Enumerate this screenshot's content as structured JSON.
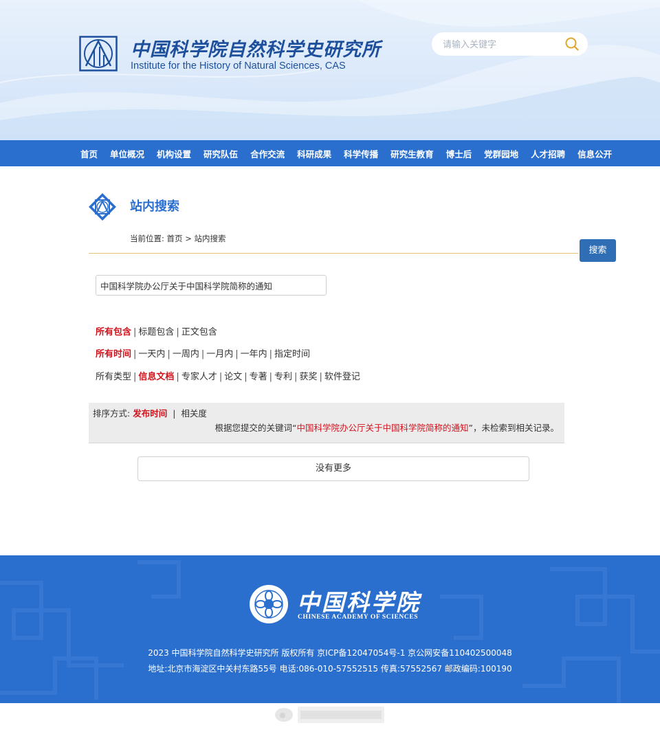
{
  "header": {
    "logo_cn": "中国科学院自然科学史研究所",
    "logo_en": "Institute for the History of Natural Sciences, CAS",
    "search_placeholder": "请输入关键字"
  },
  "nav": {
    "items": [
      "首页",
      "单位概况",
      "机构设置",
      "研究队伍",
      "合作交流",
      "科研成果",
      "科学传播",
      "研究生教育",
      "博士后",
      "党群园地",
      "人才招聘",
      "信息公开"
    ]
  },
  "page": {
    "title": "站内搜索",
    "breadcrumb_prefix": "当前位置:",
    "breadcrumb_home": "首页",
    "breadcrumb_sep": ">",
    "breadcrumb_current": "站内搜索",
    "search_button": "搜索",
    "keyword_value": "中国科学院办公厅关于中国科学院简称的通知"
  },
  "filters": {
    "scope": [
      {
        "label": "所有包含",
        "active": true
      },
      {
        "label": "标题包含",
        "active": false
      },
      {
        "label": "正文包含",
        "active": false
      }
    ],
    "time": [
      {
        "label": "所有时间",
        "active": true
      },
      {
        "label": "一天内",
        "active": false
      },
      {
        "label": "一周内",
        "active": false
      },
      {
        "label": "一月内",
        "active": false
      },
      {
        "label": "一年内",
        "active": false
      },
      {
        "label": "指定时间",
        "active": false
      }
    ],
    "type": [
      {
        "label": "所有类型",
        "active": false
      },
      {
        "label": "信息文档",
        "active": true
      },
      {
        "label": "专家人才",
        "active": false
      },
      {
        "label": "论文",
        "active": false
      },
      {
        "label": "专著",
        "active": false
      },
      {
        "label": "专利",
        "active": false
      },
      {
        "label": "获奖",
        "active": false
      },
      {
        "label": "软件登记",
        "active": false
      }
    ],
    "separator": "|"
  },
  "result": {
    "sort_label": "排序方式:",
    "sort_by_time": "发布时间",
    "sort_sep": "|",
    "sort_by_relevance": "相关度",
    "msg_prefix": "根据您提交的关键词“",
    "msg_keyword": "中国科学院办公厅关于中国科学院简称的通知",
    "msg_suffix": "”，未检索到相关记录。",
    "no_more": "没有更多"
  },
  "footer": {
    "cas_cn": "中国科学院",
    "cas_en": "CHINESE ACADEMY OF SCIENCES",
    "copyright": "2023 中国科学院自然科学史研究所 版权所有 京ICP备12047054号-1 京公网安备110402500048",
    "address": "地址:北京市海淀区中关村东路55号 电话:086-010-57552515 传真:57552567 邮政编码:100190"
  },
  "colors": {
    "brand_blue": "#2b6fce",
    "active_red": "#d0141e",
    "divider_gold": "#e8c274"
  }
}
